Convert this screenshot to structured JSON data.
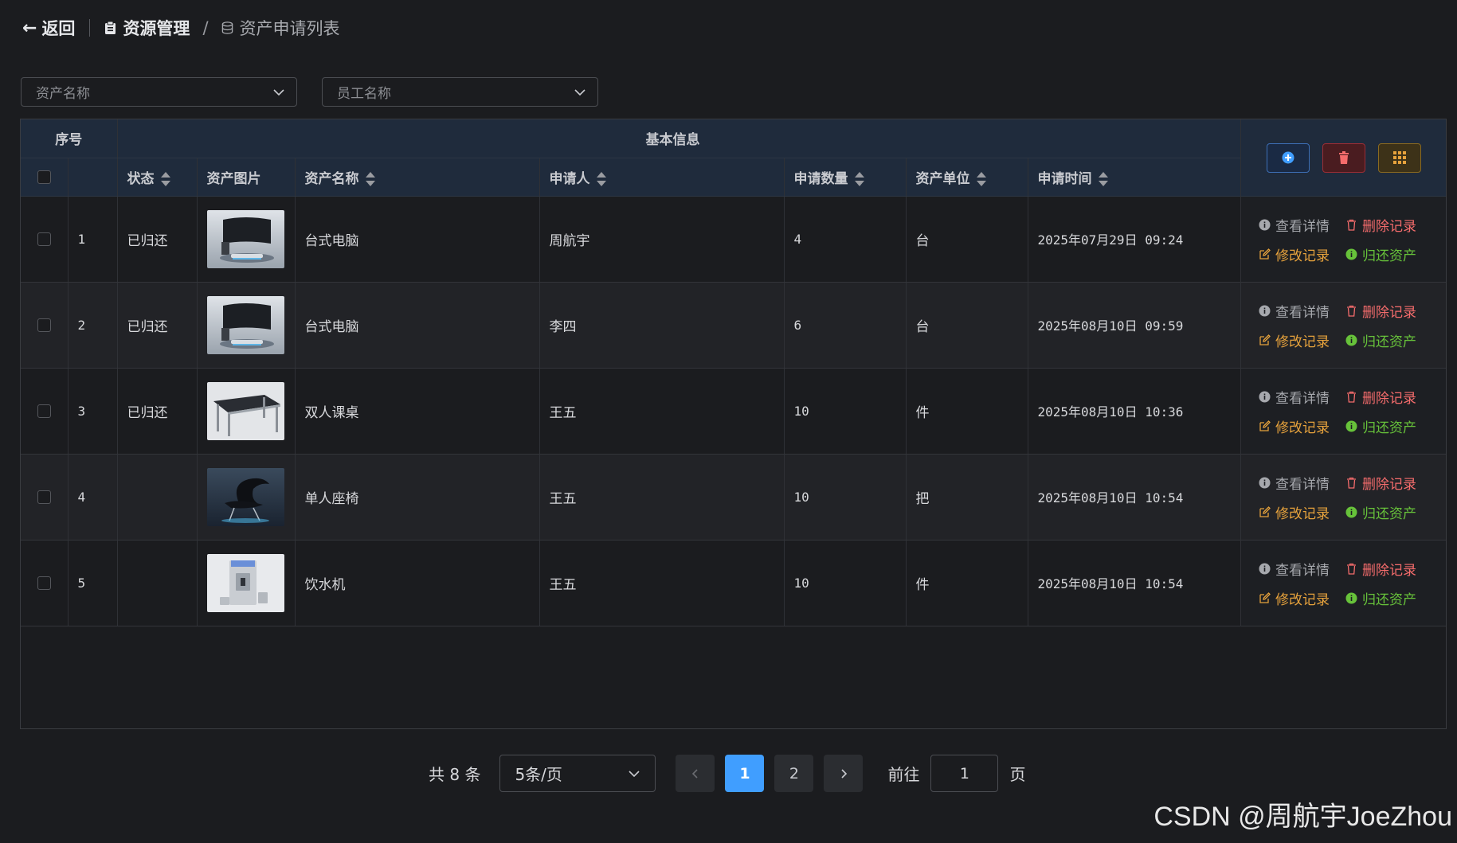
{
  "header": {
    "back_label": "返回",
    "crumb_parent": "资源管理",
    "separator": "/",
    "crumb_current": "资产申请列表"
  },
  "filters": {
    "asset_name_placeholder": "资产名称",
    "employee_name_placeholder": "员工名称"
  },
  "table": {
    "group_header_index": "序号",
    "group_header_basic": "基本信息",
    "columns": {
      "status": "状态",
      "image": "资产图片",
      "name": "资产名称",
      "applicant": "申请人",
      "quantity": "申请数量",
      "unit": "资产单位",
      "time": "申请时间"
    },
    "rows": [
      {
        "index": "1",
        "status": "已归还",
        "image": "desktop-computer",
        "name": "台式电脑",
        "applicant": "周航宇",
        "quantity": "4",
        "unit": "台",
        "time": "2025年07月29日 09:24"
      },
      {
        "index": "2",
        "status": "已归还",
        "image": "desktop-computer",
        "name": "台式电脑",
        "applicant": "李四",
        "quantity": "6",
        "unit": "台",
        "time": "2025年08月10日 09:59"
      },
      {
        "index": "3",
        "status": "已归还",
        "image": "double-desk",
        "name": "双人课桌",
        "applicant": "王五",
        "quantity": "10",
        "unit": "件",
        "time": "2025年08月10日 10:36"
      },
      {
        "index": "4",
        "status": "",
        "image": "single-chair",
        "name": "单人座椅",
        "applicant": "王五",
        "quantity": "10",
        "unit": "把",
        "time": "2025年08月10日 10:54"
      },
      {
        "index": "5",
        "status": "",
        "image": "water-dispenser",
        "name": "饮水机",
        "applicant": "王五",
        "quantity": "10",
        "unit": "件",
        "time": "2025年08月10日 10:54"
      }
    ],
    "actions": {
      "view": "查看详情",
      "delete": "删除记录",
      "edit": "修改记录",
      "return": "归还资产"
    }
  },
  "pagination": {
    "total_text": "共 8 条",
    "page_size": "5条/页",
    "pages": [
      "1",
      "2"
    ],
    "current_page": "1",
    "goto_label": "前往",
    "goto_value": "1",
    "page_suffix": "页"
  },
  "watermark": "CSDN @周航宇JoeZhou",
  "colors": {
    "accent": "#409eff",
    "danger": "#f56c6c",
    "warning": "#e6a23c",
    "success": "#67c23a"
  }
}
